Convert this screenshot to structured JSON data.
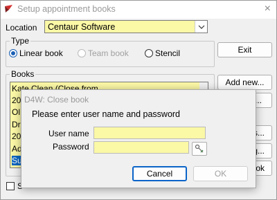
{
  "window": {
    "title": "Setup appointment books",
    "app_icon": "app-logo-icon",
    "close_icon": "×"
  },
  "location": {
    "label": "Location",
    "value": "Centaur Software",
    "dropdown_icon": "chevron-down-icon"
  },
  "type_group": {
    "title": "Type",
    "options": [
      {
        "label": "Linear book",
        "selected": true,
        "enabled": true
      },
      {
        "label": "Team book",
        "selected": false,
        "enabled": false
      },
      {
        "label": "Stencil",
        "selected": false,
        "enabled": true
      }
    ]
  },
  "books_group": {
    "title": "Books",
    "items": [
      "Kate Clean (Close from",
      "20",
      "Ol",
      "Dr",
      "20",
      "Ad",
      "Su"
    ],
    "selected_index": 6
  },
  "buttons": {
    "exit": "Exit",
    "add_new": "Add new...",
    "partial_1": "...",
    "partial_2": "s...",
    "partial_3": "g...",
    "partial_4": "ok"
  },
  "bottom_checkbox_partial": "S",
  "dialog": {
    "title": "D4W: Close book",
    "prompt": "Please enter user name and password",
    "username_label": "User name",
    "password_label": "Password",
    "username_value": "",
    "password_value": "",
    "key_icon": "key-pencil-icon",
    "cancel": "Cancel",
    "ok": "OK"
  },
  "colors": {
    "field_yellow": "#fbf8a6",
    "accent": "#0a66c2"
  }
}
